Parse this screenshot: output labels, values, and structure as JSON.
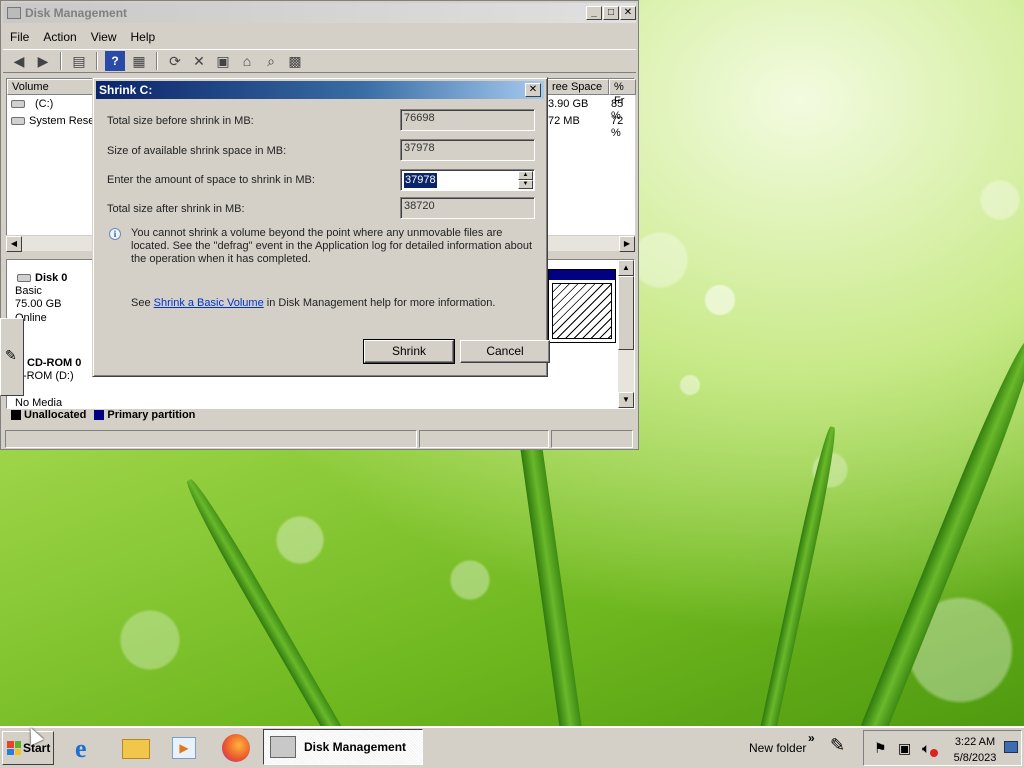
{
  "window": {
    "title": "Disk Management",
    "controls": {
      "minimize": "_",
      "maximize": "□",
      "close": "✕"
    }
  },
  "menu": {
    "file": "File",
    "action": "Action",
    "view": "View",
    "help": "Help"
  },
  "volume_list": {
    "columns": {
      "volume": "Volume",
      "free_space": "ree Space",
      "pct_free": "% Fr"
    },
    "rows": [
      {
        "name": "(C:)",
        "free": "3.90 GB",
        "pct": "85 %"
      },
      {
        "name": "System Reser",
        "free": "72 MB",
        "pct": "72 %"
      }
    ]
  },
  "disks": {
    "disk0": {
      "name": "Disk 0",
      "type": "Basic",
      "size": "75.00 GB",
      "status": "Online"
    },
    "cdrom0": {
      "name": "CD-ROM 0",
      "drive": "D-ROM (D:)",
      "status": "No Media"
    }
  },
  "legend": {
    "unallocated": "Unallocated",
    "primary": "Primary partition"
  },
  "dialog": {
    "title": "Shrink C:",
    "close": "✕",
    "total_before_label": "Total size before shrink in MB:",
    "total_before_value": "76698",
    "available_label": "Size of available shrink space in MB:",
    "available_value": "37978",
    "amount_label": "Enter the amount of space to shrink in MB:",
    "amount_value": "37978",
    "total_after_label": "Total size after shrink in MB:",
    "total_after_value": "38720",
    "info_text": "You cannot shrink a volume beyond the point where any unmovable files are located. See the \"defrag\" event in the Application log for detailed information about the operation when it has completed.",
    "help_prefix": "See ",
    "help_link": "Shrink a Basic Volume",
    "help_suffix": " in Disk Management help for more information.",
    "shrink_button": "Shrink",
    "cancel_button": "Cancel"
  },
  "taskbar": {
    "start": "Start",
    "active_task": "Disk Management",
    "toolbar_label": "New folder",
    "chevron": "»",
    "time": "3:22 AM",
    "date": "5/8/2023"
  },
  "colors": {
    "unallocated": "#000000",
    "primary_partition": "#000080",
    "dialog_title": "#0a246a"
  }
}
